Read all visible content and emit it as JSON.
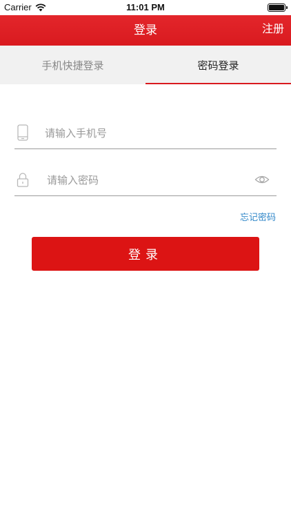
{
  "status_bar": {
    "carrier": "Carrier",
    "time": "11:01 PM"
  },
  "header": {
    "title": "登录",
    "register_label": "注册",
    "color": "#dc1e24"
  },
  "tabs": [
    {
      "label": "手机快捷登录",
      "active": false
    },
    {
      "label": "密码登录",
      "active": true
    }
  ],
  "form": {
    "phone_placeholder": "请输入手机号",
    "password_placeholder": "请输入密码",
    "forgot_label": "忘记密码",
    "login_label": "登录"
  },
  "icons": [
    "wifi-icon",
    "battery-icon",
    "phone-icon",
    "lock-icon",
    "eye-icon"
  ],
  "colors": {
    "accent": "#dc1414",
    "link": "#2f86c8",
    "tab_bg": "#f1f1f1"
  }
}
